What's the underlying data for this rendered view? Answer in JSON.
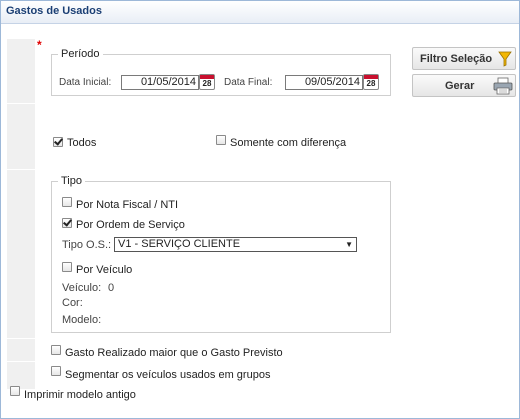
{
  "window": {
    "title": "Gastos de Usados"
  },
  "required_marker": "*",
  "periodo": {
    "legend": "Período",
    "start_label": "Data Inicial:",
    "start_value": "01/05/2014",
    "end_label": "Data Final:",
    "end_value": "09/05/2014",
    "calendar_day": "28"
  },
  "buttons": {
    "filter_label": "Filtro Seleção",
    "generate_label": "Gerar"
  },
  "scope": {
    "todos_label": "Todos",
    "todos_checked": true,
    "diferenca_label": "Somente com diferença",
    "diferenca_checked": false
  },
  "tipo": {
    "legend": "Tipo",
    "nota_fiscal_label": "Por Nota Fiscal / NTI",
    "nota_fiscal_checked": false,
    "ordem_servico_label": "Por Ordem de Serviço",
    "ordem_servico_checked": true,
    "tipo_os_label": "Tipo O.S.:",
    "tipo_os_value": "V1 - SERVIÇO CLIENTE",
    "veiculo_label": "Por Veículo",
    "veiculo_checked": false,
    "veiculo_field_label": "Veículo:",
    "veiculo_value": "0",
    "cor_label": "Cor:",
    "cor_value": "",
    "modelo_label": "Modelo:",
    "modelo_value": ""
  },
  "options": {
    "gasto_label": "Gasto Realizado maior que o Gasto Previsto",
    "gasto_checked": false,
    "segmentar_label": "Segmentar os veículos usados em grupos",
    "segmentar_checked": false,
    "imprimir_label": "Imprimir modelo antigo",
    "imprimir_checked": false
  },
  "icons": {
    "filter": "funnel-icon",
    "print": "printer-icon",
    "calendar": "calendar-icon"
  },
  "colors": {
    "title": "#1b3f74",
    "required": "#e00000",
    "funnel": "#f2b705",
    "calendar_header": "#c8102e"
  }
}
